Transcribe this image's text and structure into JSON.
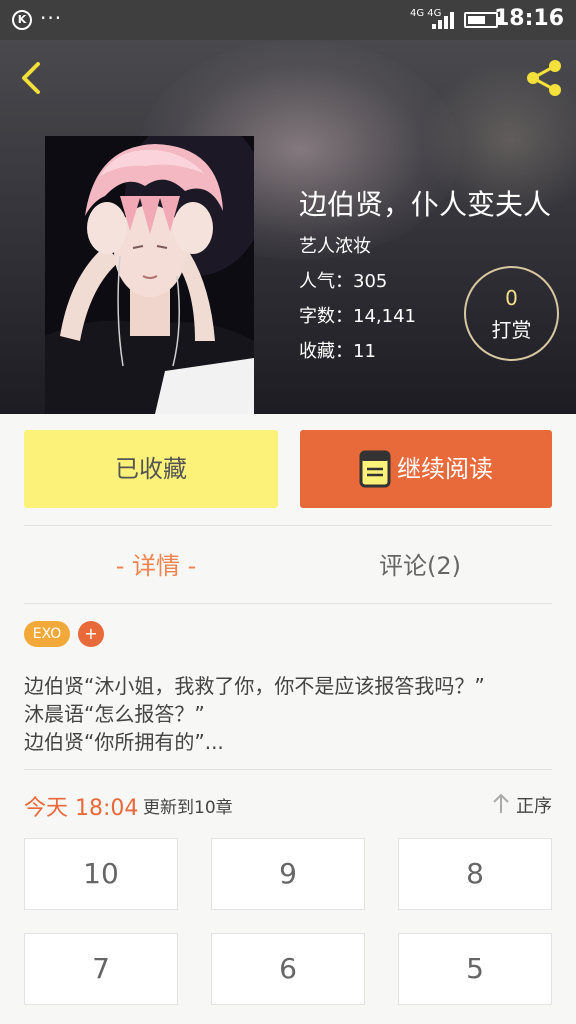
{
  "status_bar": {
    "network": "4G 4G",
    "time": "18:16"
  },
  "book": {
    "title": "边伯贤，仆人变夫人",
    "author": "艺人浓妆",
    "popularity": "人气：305",
    "word_count": "字数：14,141",
    "favorites": "收藏：11",
    "tip_count": "0",
    "tip_label": "打赏"
  },
  "actions": {
    "collected_label": "已收藏",
    "continue_label": "继续阅读"
  },
  "tabs": {
    "detail": "- 详情 -",
    "comments": "评论(2)"
  },
  "tags": {
    "exo": "EXO",
    "add": "+"
  },
  "synopsis": [
    "边伯贤“沐小姐，我救了你，你不是应该报答我吗？”",
    "沐晨语“怎么报答？”",
    "边伯贤“你所拥有的”..."
  ],
  "update": {
    "time": "今天 18:04",
    "note": "更新到10章",
    "sort_label": "正序"
  },
  "chapters": [
    "10",
    "9",
    "8",
    "7",
    "6",
    "5"
  ],
  "colors": {
    "accent_orange": "#e8693a",
    "collected_yellow": "#fcf27a",
    "back_arrow": "#f3e03a",
    "tag_exo": "#f2a93a"
  },
  "icons": {
    "back": "chevron-left-icon",
    "share": "share-icon",
    "read": "book-icon",
    "sort": "arrow-up-icon",
    "app": "k-icon"
  }
}
